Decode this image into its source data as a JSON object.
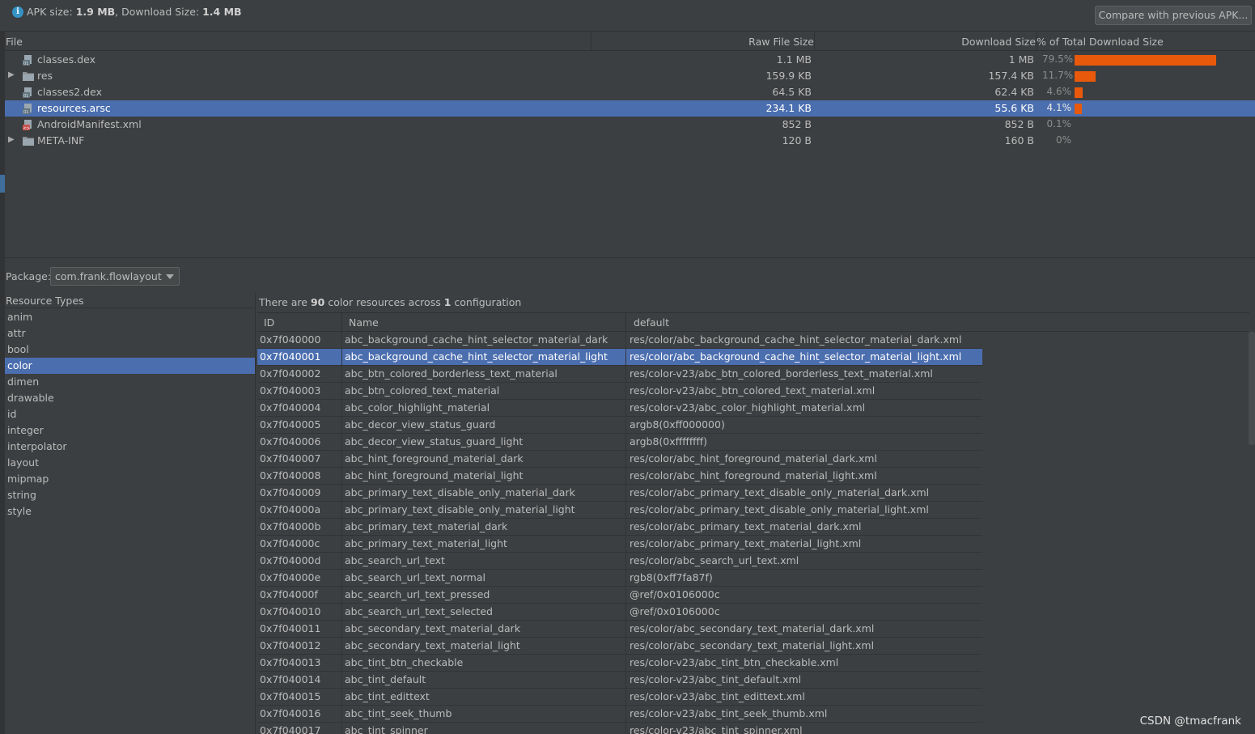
{
  "summary": {
    "apk_size_label": "APK size:",
    "apk_size_value": "1.9 MB",
    "download_size_label": ", Download Size:",
    "download_size_value": "1.4 MB",
    "compare_button": "Compare with previous APK..."
  },
  "file_table": {
    "columns": [
      "File",
      "Raw File Size",
      "Download Size",
      "% of Total Download Size"
    ],
    "rows": [
      {
        "name": "classes.dex",
        "raw": "1.1 MB",
        "download": "1 MB",
        "percent": "79.5%",
        "share": 0.795,
        "expandable": false,
        "icon": "dex-file-icon",
        "selected": false
      },
      {
        "name": "res",
        "raw": "159.9 KB",
        "download": "157.4 KB",
        "percent": "11.7%",
        "share": 0.117,
        "expandable": true,
        "icon": "folder-icon",
        "selected": false
      },
      {
        "name": "classes2.dex",
        "raw": "64.5 KB",
        "download": "62.4 KB",
        "percent": "4.6%",
        "share": 0.046,
        "expandable": false,
        "icon": "dex-file-icon",
        "selected": false
      },
      {
        "name": "resources.arsc",
        "raw": "234.1 KB",
        "download": "55.6 KB",
        "percent": "4.1%",
        "share": 0.041,
        "expandable": false,
        "icon": "arsc-file-icon",
        "selected": true
      },
      {
        "name": "AndroidManifest.xml",
        "raw": "852 B",
        "download": "852 B",
        "percent": "0.1%",
        "share": 0.001,
        "expandable": false,
        "icon": "xml-file-icon",
        "selected": false
      },
      {
        "name": "META-INF",
        "raw": "120 B",
        "download": "160 B",
        "percent": "0%",
        "share": 0.0,
        "expandable": true,
        "icon": "folder-icon",
        "selected": false
      }
    ]
  },
  "package": {
    "label": "Package:",
    "value": "com.frank.flowlayout"
  },
  "resource_types": {
    "header": "Resource Types",
    "items": [
      "anim",
      "attr",
      "bool",
      "color",
      "dimen",
      "drawable",
      "id",
      "integer",
      "interpolator",
      "layout",
      "mipmap",
      "string",
      "style"
    ],
    "selected": "color"
  },
  "resources": {
    "summary_prefix": "There are ",
    "count": "90",
    "summary_middle": " color resources across ",
    "config_count": "1",
    "summary_suffix": " configuration",
    "columns": [
      "ID",
      "Name",
      "default"
    ],
    "rows": [
      {
        "id": "0x7f040000",
        "name": "abc_background_cache_hint_selector_material_dark",
        "default": "res/color/abc_background_cache_hint_selector_material_dark.xml"
      },
      {
        "id": "0x7f040001",
        "name": "abc_background_cache_hint_selector_material_light",
        "default": "res/color/abc_background_cache_hint_selector_material_light.xml",
        "selected": true
      },
      {
        "id": "0x7f040002",
        "name": "abc_btn_colored_borderless_text_material",
        "default": "res/color-v23/abc_btn_colored_borderless_text_material.xml"
      },
      {
        "id": "0x7f040003",
        "name": "abc_btn_colored_text_material",
        "default": "res/color-v23/abc_btn_colored_text_material.xml"
      },
      {
        "id": "0x7f040004",
        "name": "abc_color_highlight_material",
        "default": "res/color-v23/abc_color_highlight_material.xml"
      },
      {
        "id": "0x7f040005",
        "name": "abc_decor_view_status_guard",
        "default": "argb8(0xff000000)"
      },
      {
        "id": "0x7f040006",
        "name": "abc_decor_view_status_guard_light",
        "default": "argb8(0xffffffff)"
      },
      {
        "id": "0x7f040007",
        "name": "abc_hint_foreground_material_dark",
        "default": "res/color/abc_hint_foreground_material_dark.xml"
      },
      {
        "id": "0x7f040008",
        "name": "abc_hint_foreground_material_light",
        "default": "res/color/abc_hint_foreground_material_light.xml"
      },
      {
        "id": "0x7f040009",
        "name": "abc_primary_text_disable_only_material_dark",
        "default": "res/color/abc_primary_text_disable_only_material_dark.xml"
      },
      {
        "id": "0x7f04000a",
        "name": "abc_primary_text_disable_only_material_light",
        "default": "res/color/abc_primary_text_disable_only_material_light.xml"
      },
      {
        "id": "0x7f04000b",
        "name": "abc_primary_text_material_dark",
        "default": "res/color/abc_primary_text_material_dark.xml"
      },
      {
        "id": "0x7f04000c",
        "name": "abc_primary_text_material_light",
        "default": "res/color/abc_primary_text_material_light.xml"
      },
      {
        "id": "0x7f04000d",
        "name": "abc_search_url_text",
        "default": "res/color/abc_search_url_text.xml"
      },
      {
        "id": "0x7f04000e",
        "name": "abc_search_url_text_normal",
        "default": "rgb8(0xff7fa87f)"
      },
      {
        "id": "0x7f04000f",
        "name": "abc_search_url_text_pressed",
        "default": "@ref/0x0106000c"
      },
      {
        "id": "0x7f040010",
        "name": "abc_search_url_text_selected",
        "default": "@ref/0x0106000c"
      },
      {
        "id": "0x7f040011",
        "name": "abc_secondary_text_material_dark",
        "default": "res/color/abc_secondary_text_material_dark.xml"
      },
      {
        "id": "0x7f040012",
        "name": "abc_secondary_text_material_light",
        "default": "res/color/abc_secondary_text_material_light.xml"
      },
      {
        "id": "0x7f040013",
        "name": "abc_tint_btn_checkable",
        "default": "res/color-v23/abc_tint_btn_checkable.xml"
      },
      {
        "id": "0x7f040014",
        "name": "abc_tint_default",
        "default": "res/color-v23/abc_tint_default.xml"
      },
      {
        "id": "0x7f040015",
        "name": "abc_tint_edittext",
        "default": "res/color-v23/abc_tint_edittext.xml"
      },
      {
        "id": "0x7f040016",
        "name": "abc_tint_seek_thumb",
        "default": "res/color-v23/abc_tint_seek_thumb.xml"
      },
      {
        "id": "0x7f040017",
        "name": "abc_tint_spinner",
        "default": "res/color-v23/abc_tint_spinner.xml"
      }
    ]
  },
  "watermark": "CSDN @tmacfrank",
  "colors": {
    "background": "#3c3f41",
    "selection": "#4b6eaf",
    "bar": "#e8590c",
    "text": "#bbbbbb",
    "info": "#3592c4"
  }
}
